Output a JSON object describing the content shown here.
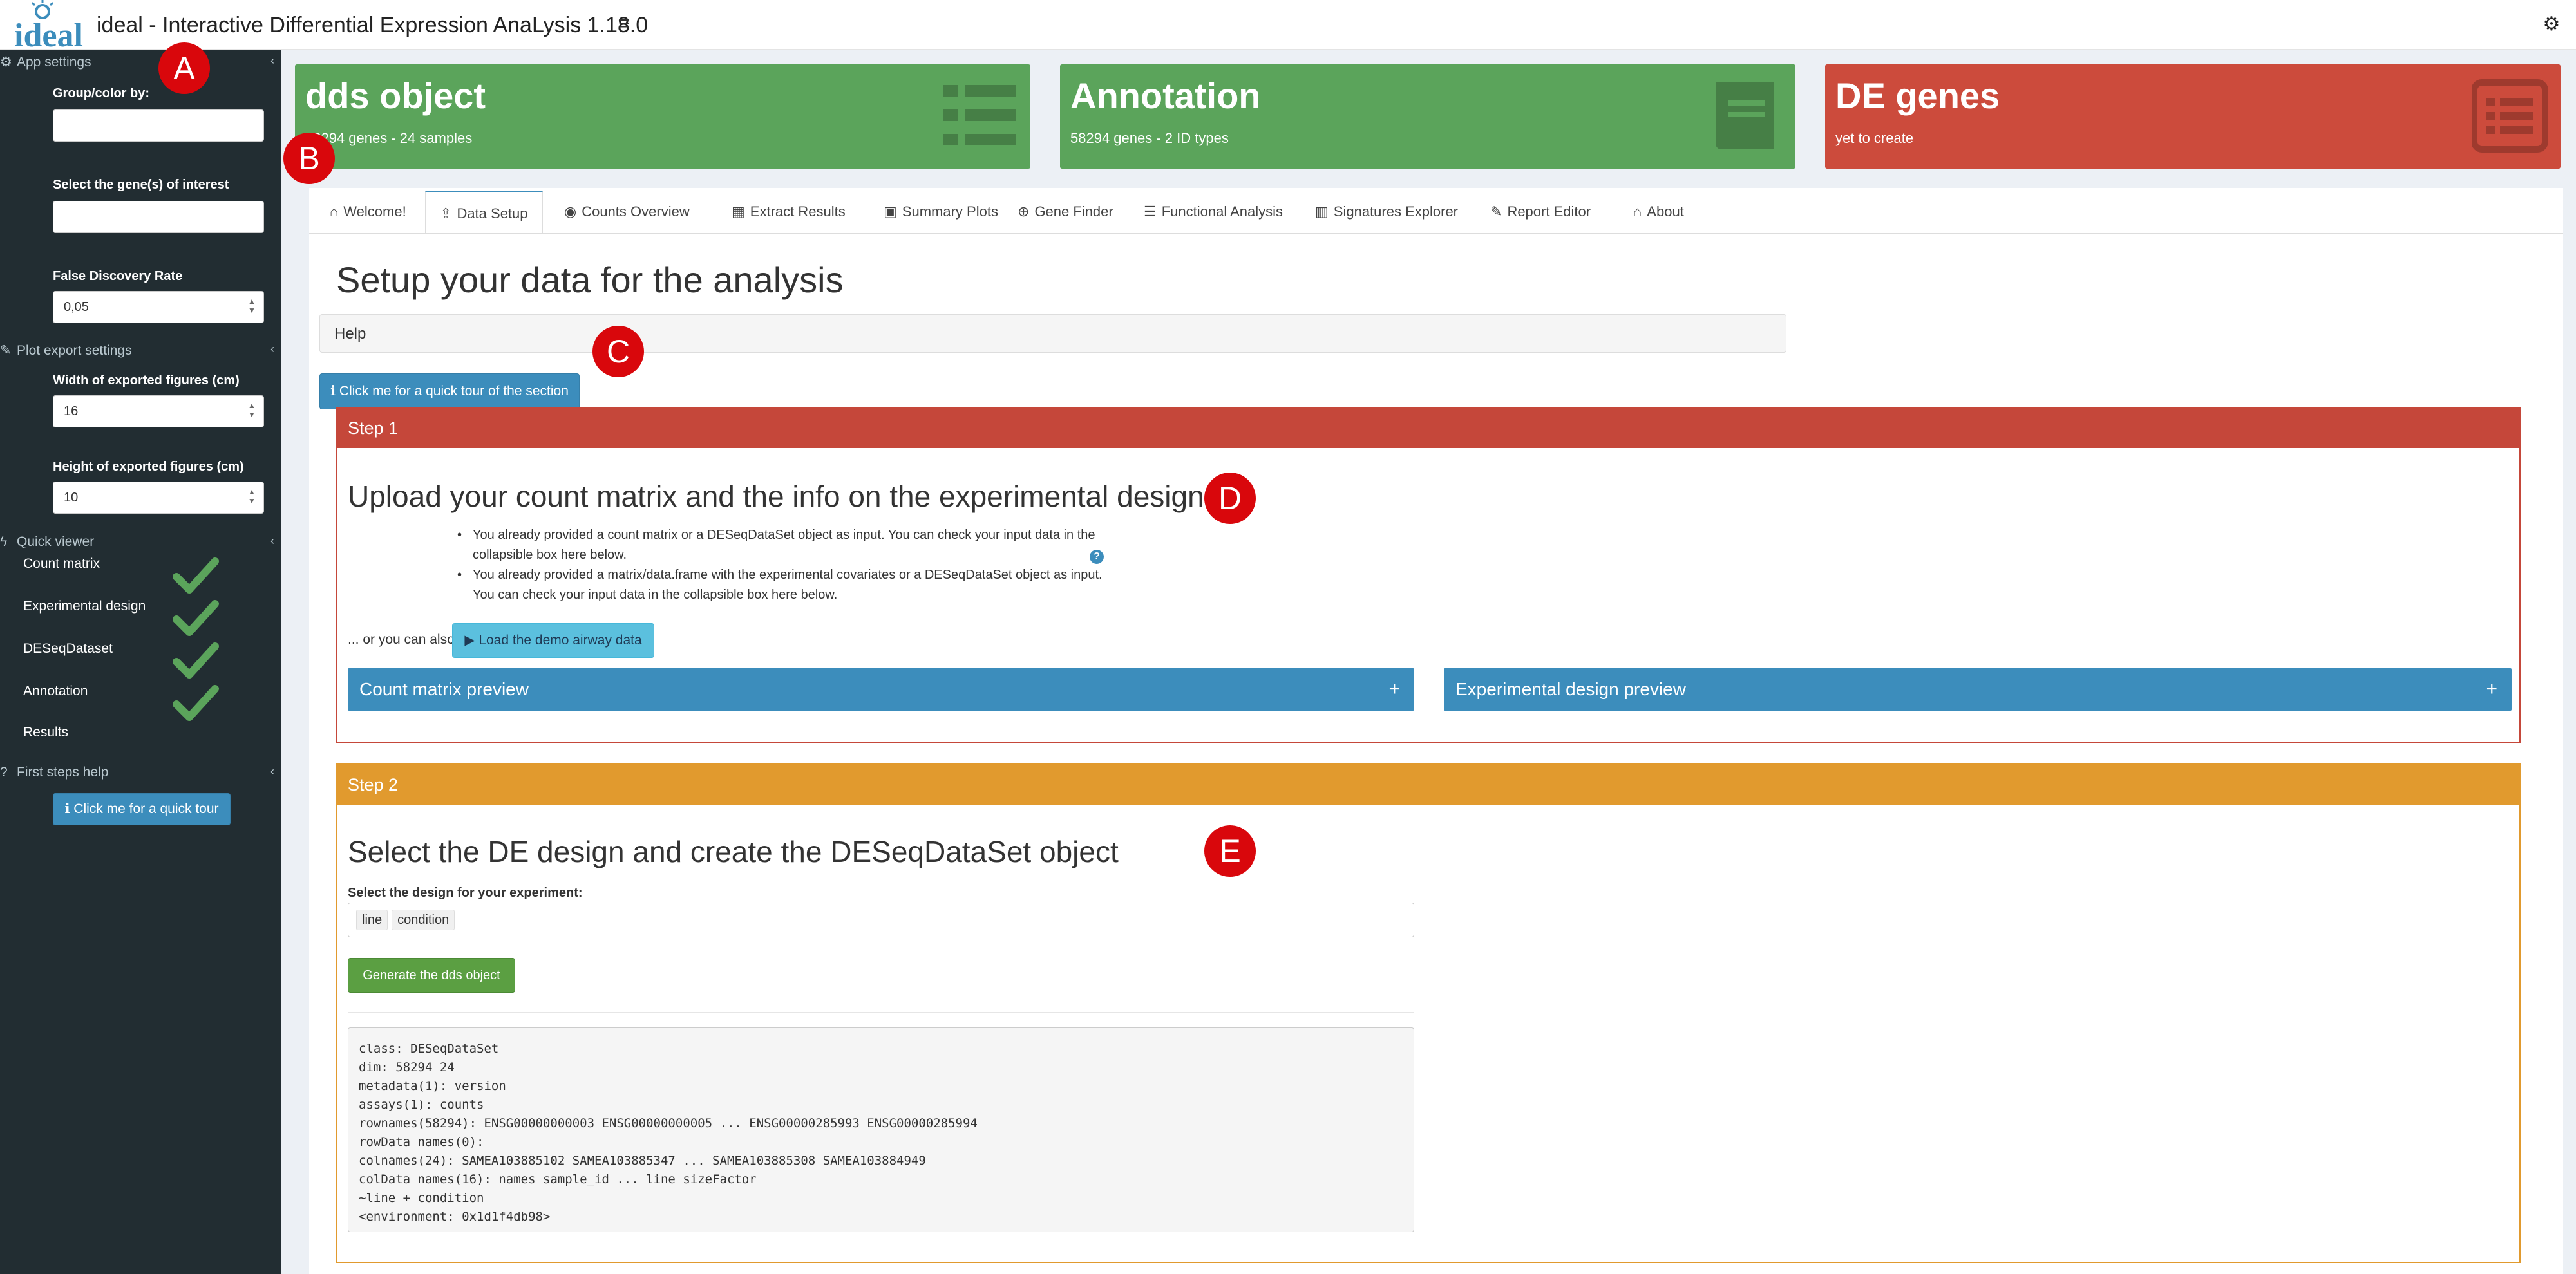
{
  "header": {
    "app_title": "ideal - Interactive Differential Expression AnaLysis 1.18.0",
    "logo_text": "ideal",
    "icons": {
      "menu": "hamburger-icon",
      "settings": "gear-icon"
    }
  },
  "sidebar": {
    "app_settings": {
      "title": "App settings",
      "icon": "gears-icon"
    },
    "group_color_label": "Group/color by:",
    "group_color_value": "",
    "genes_label": "Select the gene(s) of interest",
    "genes_value": "",
    "fdr_label": "False Discovery Rate",
    "fdr_value": "0,05",
    "plot_export": {
      "title": "Plot export settings",
      "icon": "pencil-icon"
    },
    "width_label": "Width of exported figures (cm)",
    "width_value": "16",
    "height_label": "Height of exported figures (cm)",
    "height_value": "10",
    "quick_viewer": {
      "title": "Quick viewer",
      "icon": "bolt-icon"
    },
    "qv_items": [
      {
        "label": "Count matrix",
        "ok": true
      },
      {
        "label": "Experimental design",
        "ok": true
      },
      {
        "label": "DESeqDataset",
        "ok": true
      },
      {
        "label": "Annotation",
        "ok": true
      },
      {
        "label": "Results",
        "ok": false
      }
    ],
    "first_steps": {
      "title": "First steps help",
      "icon": "question-circle-icon"
    },
    "tour_button": "Click me for a quick tour"
  },
  "value_boxes": [
    {
      "title": "dds object",
      "subtitle": "58294 genes - 24 samples",
      "color": "#5ba45b",
      "icon": "list-icon"
    },
    {
      "title": "Annotation",
      "subtitle": "58294 genes - 2 ID types",
      "color": "#5ba45b",
      "icon": "book-icon"
    },
    {
      "title": "DE genes",
      "subtitle": "yet to create",
      "color": "#cc4b3c",
      "icon": "list-alt-icon"
    }
  ],
  "tabs": [
    {
      "label": "Welcome!",
      "icon": "home-icon"
    },
    {
      "label": "Data Setup",
      "icon": "upload-icon",
      "active": true
    },
    {
      "label": "Counts Overview",
      "icon": "eye-icon"
    },
    {
      "label": "Extract Results",
      "icon": "table-icon"
    },
    {
      "label": "Summary Plots",
      "icon": "photo-icon"
    },
    {
      "label": "Gene Finder",
      "icon": "crosshairs-icon"
    },
    {
      "label": "Functional Analysis",
      "icon": "list-alt-icon"
    },
    {
      "label": "Signatures Explorer",
      "icon": "map-icon"
    },
    {
      "label": "Report Editor",
      "icon": "pencil-icon"
    },
    {
      "label": "About",
      "icon": "institution-icon"
    }
  ],
  "main": {
    "title": "Setup your data for the analysis",
    "help_label": "Help",
    "tour_button": "Click me for a quick tour of the section",
    "step1": {
      "head": "Step 1",
      "title": "Upload your count matrix and the info on the experimental design",
      "bullets": [
        "You already provided a count matrix or a DESeqDataSet object as input. You can check your input data in the collapsible box here below.",
        "You already provided a matrix/data.frame with the experimental covariates or a DESeqDataSet object as input. You can check your input data in the collapsible box here below."
      ],
      "also_text": "... or you can also",
      "demo_button": "Load the demo airway data",
      "count_preview": "Count matrix preview",
      "design_preview": "Experimental design preview",
      "color": "#c5473a"
    },
    "step2": {
      "head": "Step 2",
      "title": "Select the DE design and create the DESeqDataSet object",
      "design_label": "Select the design for your experiment:",
      "design_chips": [
        "line",
        "condition"
      ],
      "generate_button": "Generate the dds object",
      "output": "class: DESeqDataSet\ndim: 58294 24\nmetadata(1): version\nassays(1): counts\nrownames(58294): ENSG00000000003 ENSG00000000005 ... ENSG00000285993 ENSG00000285994\nrowData names(0):\ncolnames(24): SAMEA103885102 SAMEA103885347 ... SAMEA103885308 SAMEA103884949\ncolData names(16): names sample_id ... line sizeFactor\n~line + condition\n<environment: 0x1d1f4db98>",
      "color": "#e19a2e"
    }
  },
  "annotations": [
    "A",
    "B",
    "C",
    "D",
    "E"
  ]
}
